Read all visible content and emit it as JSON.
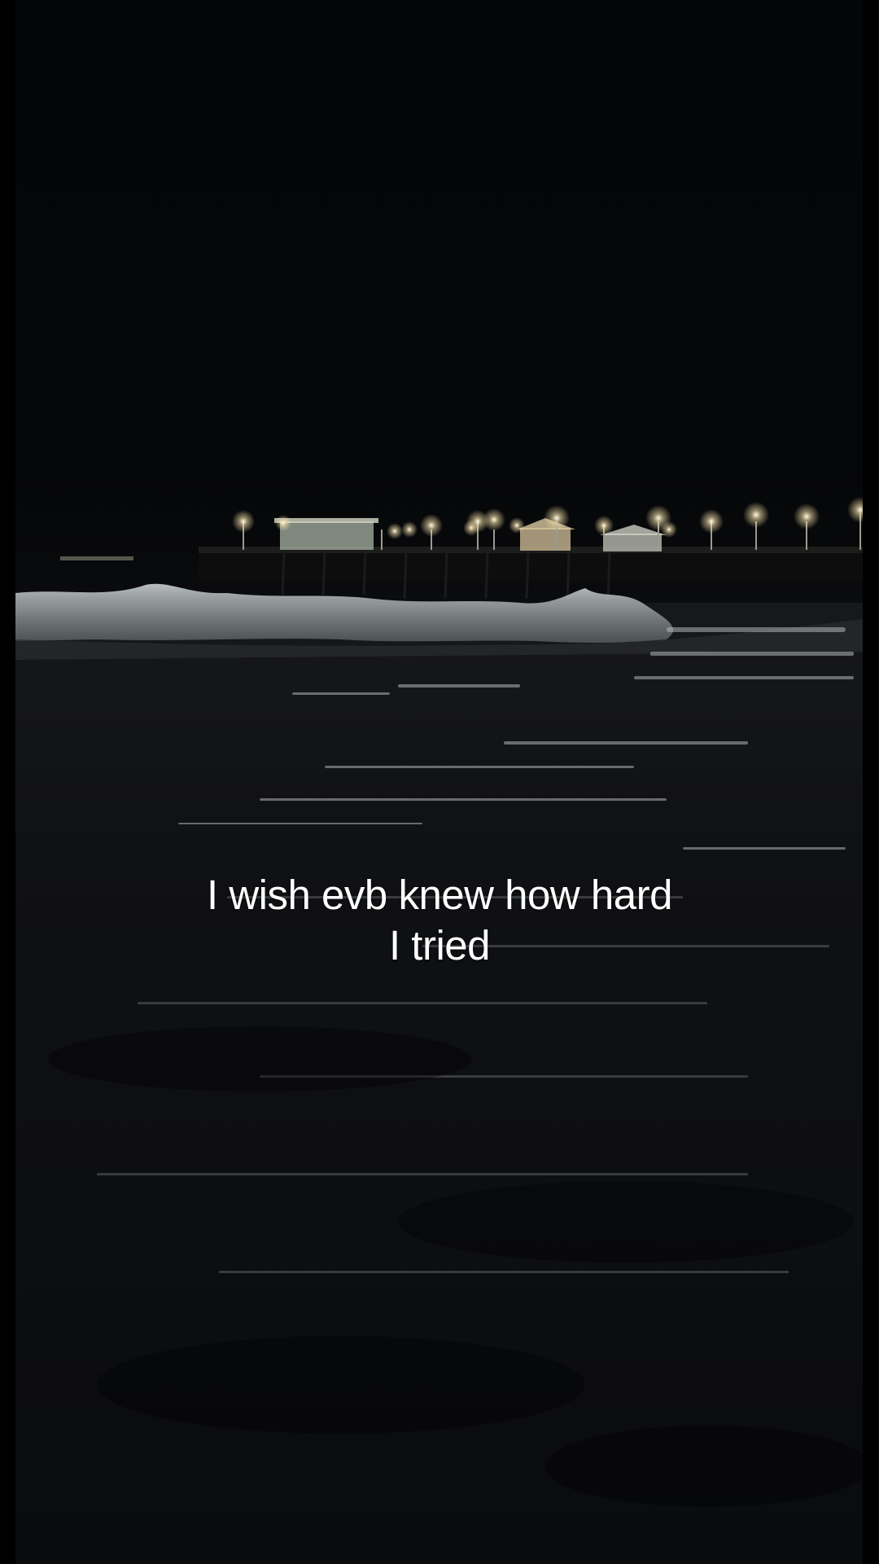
{
  "caption": {
    "line1": "I wish evb knew how hard",
    "line2": "I tried"
  },
  "scene": {
    "description_icons": [
      "pier-lights",
      "ocean-waves"
    ],
    "colors": {
      "sky": "#050608",
      "water": "#0d0e11",
      "foam": "#c9cfd0",
      "lamp": "#fff6d8"
    }
  }
}
